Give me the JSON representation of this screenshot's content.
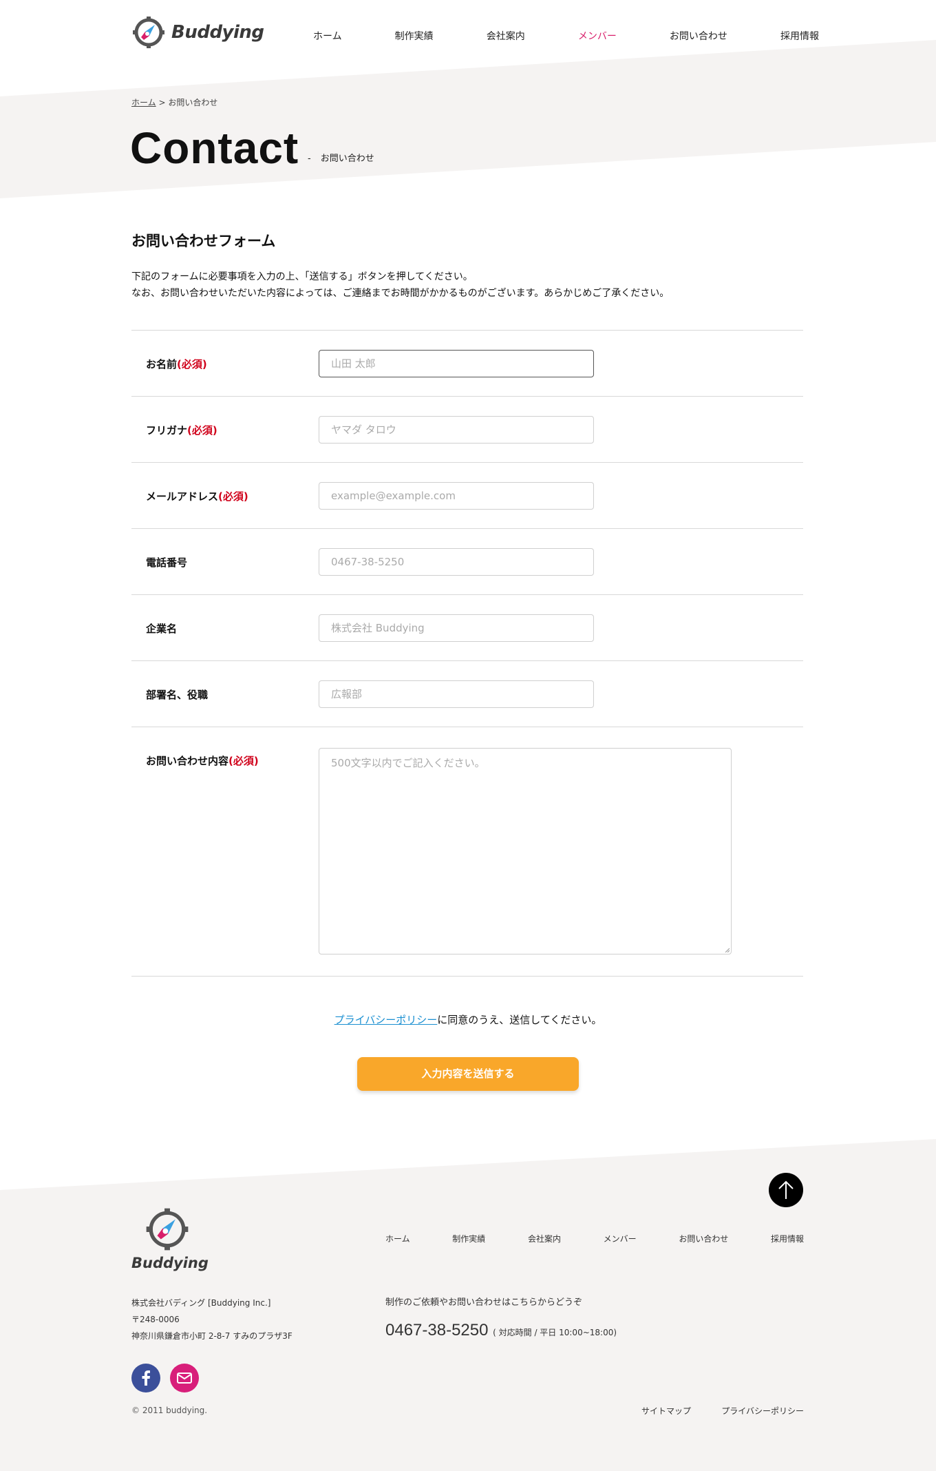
{
  "header": {
    "logo_text": "Buddying",
    "nav": [
      {
        "label": "ホーム"
      },
      {
        "label": "制作実績"
      },
      {
        "label": "会社案内"
      },
      {
        "label": "メンバー",
        "active": true
      },
      {
        "label": "お問い合わせ"
      },
      {
        "label": "採用情報"
      }
    ],
    "active_color": "#d81e6a"
  },
  "breadcrumb": {
    "home": "ホーム",
    "separator": ">",
    "current": "お問い合わせ"
  },
  "hero": {
    "title": "Contact",
    "dash": "-",
    "subtitle": "お問い合わせ"
  },
  "form": {
    "heading": "お問い合わせフォーム",
    "intro_line1": "下記のフォームに必要事項を入力の上、「送信する」ボタンを押してください。",
    "intro_line2": "なお、お問い合わせいただいた内容によっては、ご連絡までお時間がかかるものがございます。あらかじめご了承ください。",
    "required_mark": "(必須)",
    "fields": [
      {
        "label": "お名前",
        "required": true,
        "placeholder": "山田 太郎"
      },
      {
        "label": "フリガナ",
        "required": true,
        "placeholder": "ヤマダ タロウ"
      },
      {
        "label": "メールアドレス",
        "required": true,
        "placeholder": "example@example.com"
      },
      {
        "label": "電話番号",
        "required": false,
        "placeholder": "0467-38-5250"
      },
      {
        "label": "企業名",
        "required": false,
        "placeholder": "株式会社 Buddying"
      },
      {
        "label": "部署名、役職",
        "required": false,
        "placeholder": "広報部"
      },
      {
        "label": "お問い合わせ内容",
        "required": true,
        "placeholder": "500文字以内でご記入ください。"
      }
    ],
    "privacy_link": "プライバシーポリシー",
    "privacy_tail": "に同意のうえ、送信してください。",
    "submit_label": "入力内容を送信する",
    "accent_color": "#f9a72a",
    "required_color": "#d0021b"
  },
  "footer": {
    "logo_text": "Buddying",
    "nav": [
      "ホーム",
      "制作実績",
      "会社案内",
      "メンバー",
      "お問い合わせ",
      "採用情報"
    ],
    "company": "株式会社バディング [Buddying Inc.]",
    "postal": "〒248-0006",
    "address": "神奈川県鎌倉市小町 2-8-7 すみのプラザ3F",
    "lead": "制作のご依頼やお問い合わせはこちらからどうぞ",
    "phone": "0467-38-5250",
    "hours": "( 対応時間 / 平日 10:00~18:00)",
    "copyright": "© 2011 buddying.",
    "sitemap": "サイトマップ",
    "privacy": "プライバシーポリシー"
  }
}
